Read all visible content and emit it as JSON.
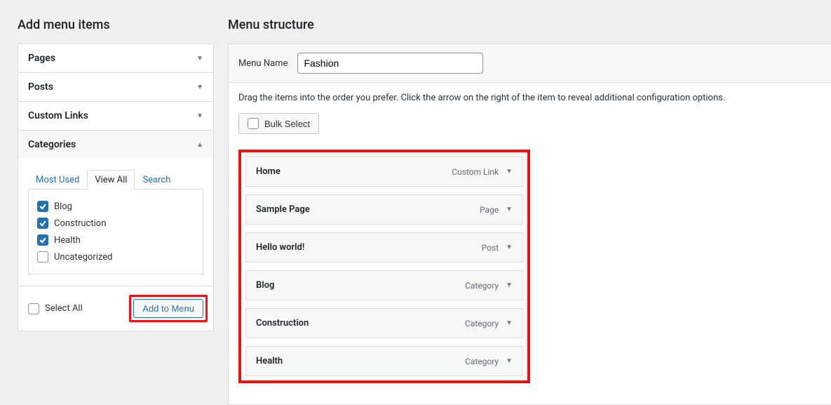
{
  "left": {
    "title": "Add menu items",
    "accordion": [
      {
        "label": "Pages",
        "open": false
      },
      {
        "label": "Posts",
        "open": false
      },
      {
        "label": "Custom Links",
        "open": false
      },
      {
        "label": "Categories",
        "open": true
      }
    ],
    "tabs": {
      "most_used": "Most Used",
      "view_all": "View All",
      "search": "Search"
    },
    "categories": [
      {
        "label": "Blog",
        "checked": true
      },
      {
        "label": "Construction",
        "checked": true
      },
      {
        "label": "Health",
        "checked": true
      },
      {
        "label": "Uncategorized",
        "checked": false
      }
    ],
    "select_all": "Select All",
    "add_to_menu": "Add to Menu"
  },
  "right": {
    "title": "Menu structure",
    "menu_name_label": "Menu Name",
    "menu_name_value": "Fashion",
    "instruction": "Drag the items into the order you prefer. Click the arrow on the right of the item to reveal additional configuration options.",
    "bulk_select": "Bulk Select",
    "items": [
      {
        "title": "Home",
        "type": "Custom Link"
      },
      {
        "title": "Sample Page",
        "type": "Page"
      },
      {
        "title": "Hello world!",
        "type": "Post"
      },
      {
        "title": "Blog",
        "type": "Category"
      },
      {
        "title": "Construction",
        "type": "Category"
      },
      {
        "title": "Health",
        "type": "Category"
      }
    ]
  }
}
